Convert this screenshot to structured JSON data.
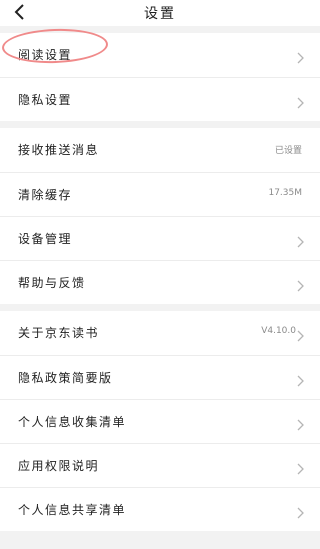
{
  "header": {
    "title": "设置",
    "back_icon": "chevron-left-icon"
  },
  "groups": [
    {
      "items": [
        {
          "label": "阅读设置",
          "value": "",
          "chevron": true
        },
        {
          "label": "隐私设置",
          "value": "",
          "chevron": true
        }
      ]
    },
    {
      "items": [
        {
          "label": "接收推送消息",
          "value": "已设置",
          "chevron": false
        },
        {
          "label": "清除缓存",
          "value": "17.35M",
          "chevron": false
        },
        {
          "label": "设备管理",
          "value": "",
          "chevron": true
        },
        {
          "label": "帮助与反馈",
          "value": "",
          "chevron": true
        }
      ]
    },
    {
      "items": [
        {
          "label": "关于京东读书",
          "value": "V4.10.0",
          "chevron": true
        },
        {
          "label": "隐私政策简要版",
          "value": "",
          "chevron": true
        },
        {
          "label": "个人信息收集清单",
          "value": "",
          "chevron": true
        },
        {
          "label": "应用权限说明",
          "value": "",
          "chevron": true
        },
        {
          "label": "个人信息共享清单",
          "value": "",
          "chevron": true
        }
      ]
    }
  ],
  "annotation": {
    "highlight_color": "#f08a8a"
  }
}
